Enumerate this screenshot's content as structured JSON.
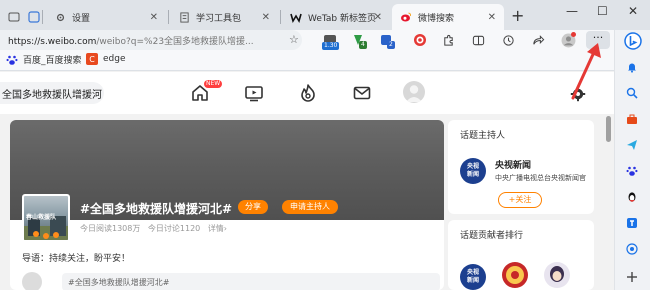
{
  "browser": {
    "tabs": [
      {
        "title": "设置",
        "icon": "gear-icon"
      },
      {
        "title": "学习工具包",
        "icon": "doc-icon"
      },
      {
        "title": "WeTab 新标签页",
        "icon": "wetab-icon"
      },
      {
        "title": "微博搜索",
        "icon": "weibo-icon",
        "active": true
      }
    ],
    "address": {
      "host": "https://s.weibo.com",
      "path": "/weibo?q=%23全国多地救援队增援..."
    },
    "extension_badges": [
      "1.30",
      "4",
      "2"
    ],
    "bookmarks": [
      {
        "label": "百度_百度搜索",
        "icon": "baidu-icon"
      },
      {
        "label": "edge",
        "icon": "edge-c-icon"
      }
    ],
    "accent": "#1a73e8"
  },
  "weibo": {
    "search_text": "全国多地救援队增援河",
    "nav_new_badge": "NEW",
    "topic": {
      "title": "#全国多地救援队增援河北#",
      "thumb_text": "春山救援队",
      "share_label": "分享",
      "host_apply_label": "申请主持人",
      "reads": "今日阅读1308万",
      "discussions": "今日讨论1120",
      "detail": "详情›",
      "intro": "导语：持续关注，盼平安！",
      "comment_placeholder": "#全国多地救援队增援河北#"
    },
    "host_panel": {
      "title": "话题主持人",
      "host_name": "央视新闻",
      "host_logo": "央视\n新闻",
      "host_desc": "中央广播电视总台央视新闻官",
      "follow_label": "+关注"
    },
    "contrib_panel": {
      "title": "话题贡献者排行",
      "first_logo": "央视\n新闻"
    },
    "accent": "#ff8200"
  }
}
